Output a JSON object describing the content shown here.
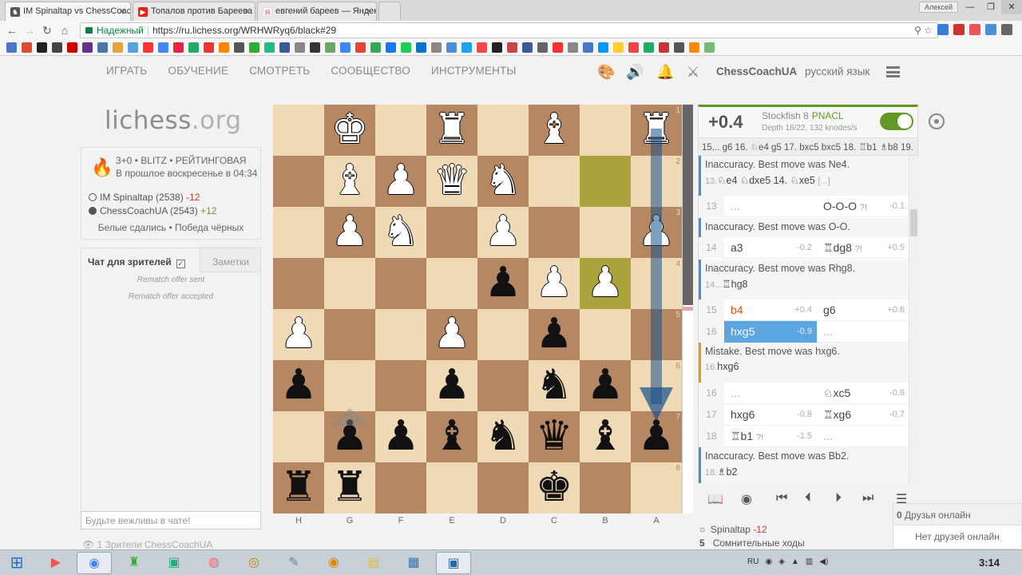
{
  "browser": {
    "tabs": [
      {
        "title": "IM Spinaltap vs ChessCoach",
        "favicon": "#555555",
        "active": true
      },
      {
        "title": "Топалов против Бареева",
        "favicon": "#e62117",
        "active": false
      },
      {
        "title": "евгений бареев — Яндекс",
        "favicon": "#ff3333",
        "active": false
      }
    ],
    "user_chip": "Алексей",
    "secure_label": "Надежный",
    "url": "https://ru.lichess.org/WRHWRyq6/black#29",
    "win_min": "—",
    "win_max": "❐",
    "win_close": "✕"
  },
  "header": {
    "nav": [
      "ИГРАТЬ",
      "ОБУЧЕНИЕ",
      "СМОТРЕТЬ",
      "СООБЩЕСТВО",
      "ИНСТРУМЕНТЫ"
    ],
    "username": "ChessCoachUA",
    "language": "русский язык"
  },
  "logo": {
    "main": "lichess",
    "tld": ".org"
  },
  "game_info": {
    "type": "3+0 • BLITZ • РЕЙТИНГОВАЯ",
    "date": "В прошлое воскресенье в 04:34",
    "white_player": "IM Spinaltap (2538)",
    "white_diff": "-12",
    "black_player": "ChessCoachUA (2543)",
    "black_diff": "+12",
    "result": "Белые сдались • Победа чёрных"
  },
  "chat": {
    "tab_chat": "Чат для зрителей",
    "tab_notes": "Заметки",
    "messages": [
      "Rematch offer sent",
      "Rematch offer accepted"
    ],
    "placeholder": "Будьте вежливы в чате!",
    "watchers": "1 Зрители ChessCoachUA"
  },
  "board": {
    "files": [
      "H",
      "G",
      "F",
      "E",
      "D",
      "C",
      "B",
      "A"
    ],
    "ranks": [
      "1",
      "2",
      "3",
      "4",
      "5",
      "6",
      "7",
      "8"
    ],
    "rows": [
      [
        ".",
        "K",
        ".",
        "R",
        ".",
        "B",
        ".",
        "R"
      ],
      [
        ".",
        "B",
        "P",
        "Q",
        "N",
        ".",
        ".",
        "."
      ],
      [
        ".",
        "P",
        "N",
        ".",
        "P",
        ".",
        ".",
        "P"
      ],
      [
        ".",
        ".",
        ".",
        ".",
        "p",
        "P",
        "P",
        "."
      ],
      [
        "P",
        ".",
        ".",
        "P",
        ".",
        "p",
        ".",
        "."
      ],
      [
        "p",
        ".",
        ".",
        "p",
        ".",
        "n",
        "p",
        "."
      ],
      [
        ".",
        "p",
        "p",
        "b",
        "n",
        "q",
        "b",
        "p"
      ],
      [
        "r",
        "r",
        ".",
        ".",
        ".",
        "k",
        ".",
        "."
      ]
    ],
    "highlights": [
      "1,6",
      "3,6"
    ],
    "eval_black_fraction": 0.49
  },
  "engine": {
    "score": "+0.4",
    "name": "Stockfish 8",
    "build": "PNACL",
    "depth": "Depth 18/22, 132 knodes/s",
    "pv": "15... g6 16. ♘e4 g5 17. bxc5 bxc5 18. ♖b1 ♗b8 19."
  },
  "moves": {
    "c1_title": "Inaccuracy. Best move was Ne4.",
    "c1_num": "13.",
    "c1_line": "♘e4 ♘dxe5 14. ♘xe5",
    "c1_bracket": "[...]",
    "r13_num": "13",
    "r13_w": "...",
    "r13_b": "O-O-O",
    "r13_b_ann": "?!",
    "r13_b_ev": "-0.1",
    "c2_title": "Inaccuracy. Best move was O-O.",
    "r14_num": "14",
    "r14_w": "a3",
    "r14_w_ev": "-0.2",
    "r14_b": "♖dg8",
    "r14_b_ann": "?!",
    "r14_b_ev": "+0.5",
    "c3_title": "Inaccuracy. Best move was Rhg8.",
    "c3_num": "14...",
    "c3_line": "♖hg8",
    "r15_num": "15",
    "r15_w": "b4",
    "r15_w_ev": "+0.4",
    "r15_b": "g6",
    "r15_b_ev": "+0.6",
    "r16_num": "16",
    "r16_w": "hxg5",
    "r16_w_ev": "-0.9",
    "r16_b": "...",
    "c4_title": "Mistake. Best move was hxg6.",
    "c4_num": "16.",
    "c4_line": "hxg6",
    "r16b_num": "16",
    "r16b_w": "...",
    "r16b_b": "♘xc5",
    "r16b_b_ev": "-0.8",
    "r17_num": "17",
    "r17_w": "hxg6",
    "r17_w_ev": "-0.8",
    "r17_b": "♖xg6",
    "r17_b_ev": "-0.7",
    "r18_num": "18",
    "r18_w": "♖b1",
    "r18_w_ann": "?!",
    "r18_w_ev": "-1.5",
    "r18_b": "...",
    "c5_title": "Inaccuracy. Best move was Bb2.",
    "c5_num": "18.",
    "c5_line": "♗b2"
  },
  "friends": {
    "count": "0",
    "label": "Друзья онлайн",
    "empty": "Нет друзей онлайн"
  },
  "summary": {
    "p1": "Spinaltap",
    "p1_diff": "-12",
    "dubious_count": "5",
    "dubious_label": "Сомнительные ходы"
  },
  "taskbar": {
    "lang": "RU",
    "time": "3:14"
  }
}
